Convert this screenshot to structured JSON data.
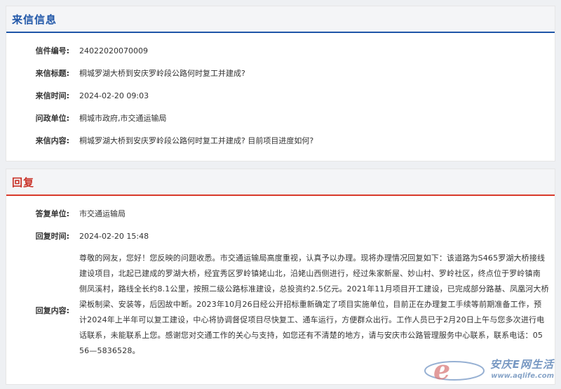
{
  "letter": {
    "section_title": "来信信息",
    "fields": [
      {
        "label": "信件编号:",
        "value": "24022020070009"
      },
      {
        "label": "来信标题:",
        "value": "桐城罗湖大桥到安庆罗岭段公路何时复工并建成?"
      },
      {
        "label": "来信时间:",
        "value": "2024-02-20 09:03"
      },
      {
        "label": "问政单位:",
        "value": "桐城市政府,市交通运输局"
      },
      {
        "label": "来信内容:",
        "value": "桐城罗湖大桥到安庆罗岭段公路何时复工并建成? 目前项目进度如何?"
      }
    ]
  },
  "reply": {
    "section_title": "回复",
    "fields": [
      {
        "label": "答复单位:",
        "value": "市交通运输局"
      },
      {
        "label": "回复时间:",
        "value": "2024-02-20 15:48"
      }
    ],
    "content_label": "回复内容:",
    "content_lines": [
      "尊敬的网友，您好！您反映的问题收悉。市交通运输局高度重视，认真予以办理。现将办理情况回复如下：该道路为S465罗湖大桥接线",
      "建设项目，北起已建成的罗湖大桥，经宜秀区罗岭镇姥山北，沿姥山西侧进行，经过朱家新屋、妙山村、罗岭社区，终点位于罗岭镇南",
      "侧凤溪村，路线全长约8.1公里，按照二级公路标准建设，总投资约2.5亿元。2021年11月项目开工建设，已完成部分路基、凤凰河大桥",
      "梁板制梁、安装等，后因故中断。2023年10月26日经公开招标重新确定了项目实施单位，目前正在办理复工手续等前期准备工作，预",
      "计2024年上半年可以复工建设，中心将协调督促项目尽快复工、通车运行，方便群众出行。工作人员已于2月20日上午与您多次进行电",
      "话联系，未能联系上您。感谢您对交通工作的关心与支持，如您还有不清楚的地方，请与安庆市公路管理服务中心联系，联系电话：05",
      "56—5836528。"
    ]
  },
  "watermark": {
    "brand": "安庆E网生活",
    "url": "www.aqlife.com"
  },
  "colors": {
    "letter_accent": "#1f56a8",
    "reply_accent": "#d93a2b",
    "panel_header_bg": "#f4f5f7",
    "page_bg": "#eef0f3"
  }
}
